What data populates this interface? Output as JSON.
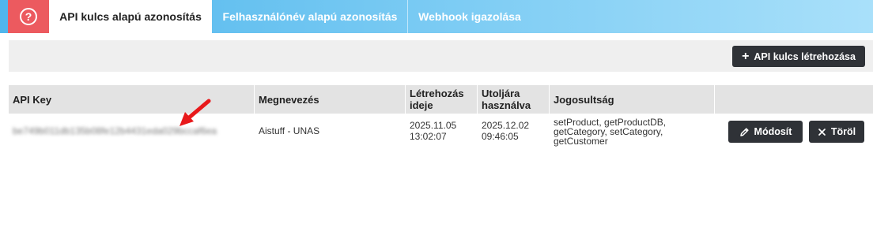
{
  "tabs": {
    "help_icon": "help-circle-icon",
    "help_glyph": "?",
    "items": [
      {
        "label": "API kulcs alapú azonosítás",
        "active": true
      },
      {
        "label": "Felhasználónév alapú azonosítás",
        "active": false
      },
      {
        "label": "Webhook igazolása",
        "active": false
      }
    ]
  },
  "toolbar": {
    "create_label": "API kulcs létrehozása",
    "create_icon": "plus-icon"
  },
  "table": {
    "headers": {
      "api_key": "API Key",
      "name": "Megnevezés",
      "created": "Létrehozás ideje",
      "last_used": "Utoljára használva",
      "permissions": "Jogosultság"
    },
    "rows": [
      {
        "api_key": "be749b011db135b08fe12b4431eda029bccaf6ea",
        "name": "Aistuff - UNAS",
        "created": "2025.11.05 13:02:07",
        "last_used": "2025.12.02 09:46:05",
        "permissions": "setProduct, getProductDB, getCategory, setCategory, getCustomer",
        "edit_label": "Módosít",
        "edit_icon": "pencil-icon",
        "delete_label": "Töröl",
        "delete_icon": "close-icon"
      }
    ]
  },
  "colors": {
    "help_tab": "#ec5a5f",
    "tab_gradient_start": "#4fb6ec",
    "tab_gradient_end": "#a9e0fa",
    "button_dark": "#2f3237",
    "annotation_arrow": "#e8191b"
  }
}
